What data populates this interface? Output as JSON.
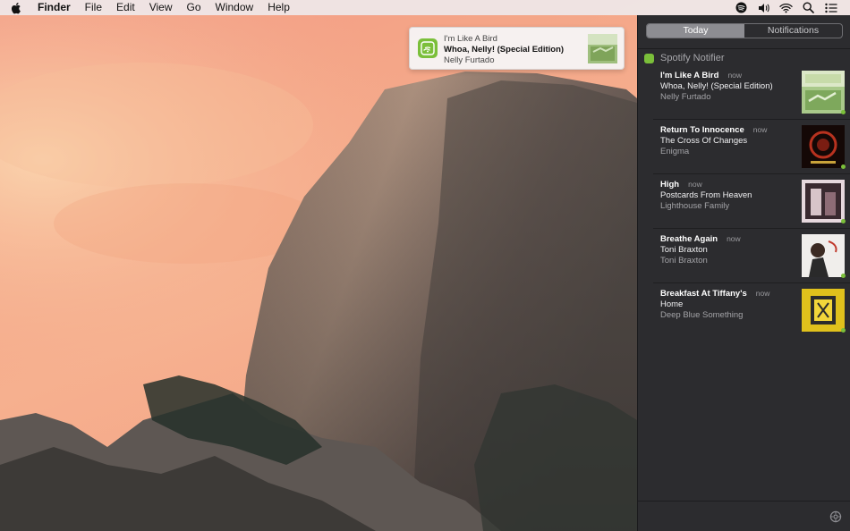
{
  "menubar": {
    "apple_icon": "apple-icon",
    "items": [
      "Finder",
      "File",
      "Edit",
      "View",
      "Go",
      "Window",
      "Help"
    ],
    "status_icons": [
      "spotify-icon",
      "volume-icon",
      "wifi-icon",
      "search-icon",
      "list-icon"
    ]
  },
  "banner": {
    "title": "I'm Like A Bird",
    "subtitle": "Whoa, Nelly! (Special Edition)",
    "artist": "Nelly Furtado",
    "icon": "spotify-notifier-icon"
  },
  "notification_center": {
    "tabs": [
      {
        "label": "Today",
        "active": true
      },
      {
        "label": "Notifications",
        "active": false
      }
    ],
    "app_name": "Spotify Notifier",
    "items": [
      {
        "title": "I'm Like A Bird",
        "time": "now",
        "album": "Whoa, Nelly! (Special Edition)",
        "artist": "Nelly Furtado",
        "art_color": "#a9c98a"
      },
      {
        "title": "Return To Innocence",
        "time": "now",
        "album": "The Cross Of Changes",
        "artist": "Enigma",
        "art_color": "#5a1a14"
      },
      {
        "title": "High",
        "time": "now",
        "album": "Postcards From Heaven",
        "artist": "Lighthouse Family",
        "art_color": "#d8c6cc"
      },
      {
        "title": "Breathe Again",
        "time": "now",
        "album": "Toni Braxton",
        "artist": "Toni Braxton",
        "art_color": "#e9e7e5"
      },
      {
        "title": "Breakfast At Tiffany's",
        "time": "now",
        "album": "Home",
        "artist": "Deep Blue Something",
        "art_color": "#e0c11c"
      }
    ],
    "settings_icon": "gear-icon"
  },
  "colors": {
    "accent_green": "#7bbf3a",
    "panel_bg": "#2c2c2f"
  }
}
